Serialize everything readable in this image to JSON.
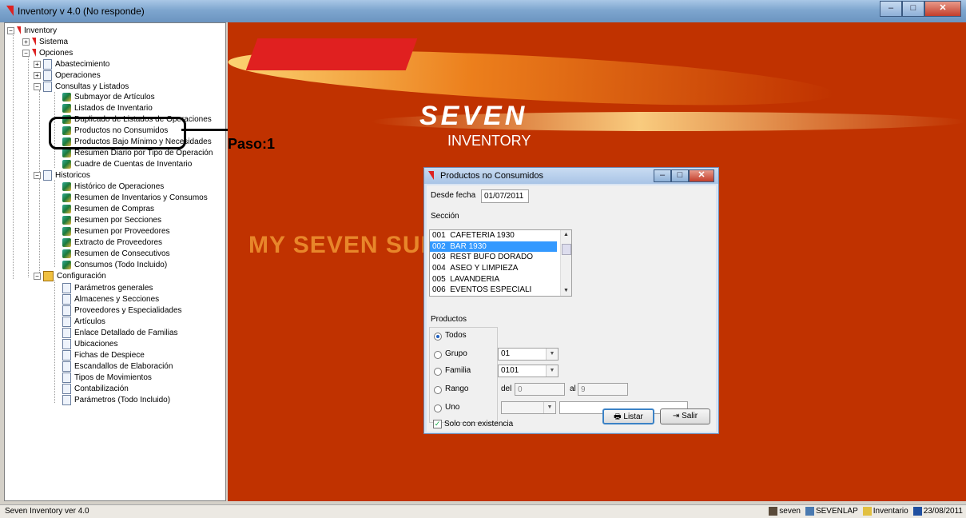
{
  "window": {
    "title": "Inventory v 4.0 (No responde)"
  },
  "tree": {
    "nodes": [
      {
        "label": "Inventory"
      },
      {
        "label": "Sistema"
      },
      {
        "label": "Opciones"
      },
      {
        "label": "Abastecimiento"
      },
      {
        "label": "Operaciones"
      },
      {
        "label": "Consultas y Listados"
      },
      {
        "label": "Submayor de Artículos"
      },
      {
        "label": "Listados de Inventario"
      },
      {
        "label": "Duplicado de Listados de Operaciones"
      },
      {
        "label": "Productos no Consumidos"
      },
      {
        "label": "Productos Bajo Mínimo y Necesidades"
      },
      {
        "label": "Resumen Diario por Tipo de Operación"
      },
      {
        "label": "Cuadre de Cuentas de Inventario"
      },
      {
        "label": "Historicos"
      },
      {
        "label": "Histórico de Operaciones"
      },
      {
        "label": "Resumen de Inventarios y Consumos"
      },
      {
        "label": "Resumen de Compras"
      },
      {
        "label": "Resumen por Secciones"
      },
      {
        "label": "Resumen por Proveedores"
      },
      {
        "label": "Extracto de Proveedores"
      },
      {
        "label": "Resumen de Consecutivos"
      },
      {
        "label": "Consumos (Todo Incluido)"
      },
      {
        "label": "Configuración"
      },
      {
        "label": "Parámetros generales"
      },
      {
        "label": "Almacenes y Secciones"
      },
      {
        "label": "Proveedores y Especialidades"
      },
      {
        "label": "Artículos"
      },
      {
        "label": "Enlace Detallado de Familias"
      },
      {
        "label": "Ubicaciones"
      },
      {
        "label": "Fichas de Despiece"
      },
      {
        "label": "Escandallos de Elaboración"
      },
      {
        "label": "Tipos de Movimientos"
      },
      {
        "label": "Contabilización"
      },
      {
        "label": "Parámetros (Todo Incluido)"
      }
    ]
  },
  "annotation": {
    "label": "Paso:1"
  },
  "desktop": {
    "logo_main": "SEVEN",
    "logo_sub": "INVENTORY",
    "suite_text": "MY SEVEN SUITE"
  },
  "dialog": {
    "title": "Productos no Consumidos",
    "desde_fecha_label": "Desde fecha",
    "desde_fecha_value": "01/07/2011",
    "seccion_label": "Sección",
    "secciones": [
      {
        "code": "001",
        "name": "CAFETERIA 1930"
      },
      {
        "code": "002",
        "name": "BAR 1930"
      },
      {
        "code": "003",
        "name": "REST BUFO DORADO"
      },
      {
        "code": "004",
        "name": "ASEO Y LIMPIEZA"
      },
      {
        "code": "005",
        "name": "LAVANDERIA"
      },
      {
        "code": "006",
        "name": "EVENTOS ESPECIALI"
      }
    ],
    "selected_seccion_index": 1,
    "productos_label": "Productos",
    "options": {
      "todos": "Todos",
      "grupo": "Grupo",
      "familia": "Familia",
      "rango": "Rango",
      "uno": "Uno"
    },
    "selected_option": "todos",
    "grupo_value": "01",
    "familia_value": "0101",
    "rango_del_label": "del",
    "rango_del_value": "0",
    "rango_al_label": "al",
    "rango_al_value": "9",
    "uno_combo_value": "",
    "uno_text_value": "",
    "solo_existencia_label": "Solo con existencia",
    "solo_existencia_checked": true,
    "listar_label": "Listar",
    "salir_label": "Salir"
  },
  "status": {
    "left": "Seven Inventory ver 4.0",
    "user": "seven",
    "host": "SEVENLAP",
    "db": "Inventario",
    "date": "23/08/2011"
  }
}
